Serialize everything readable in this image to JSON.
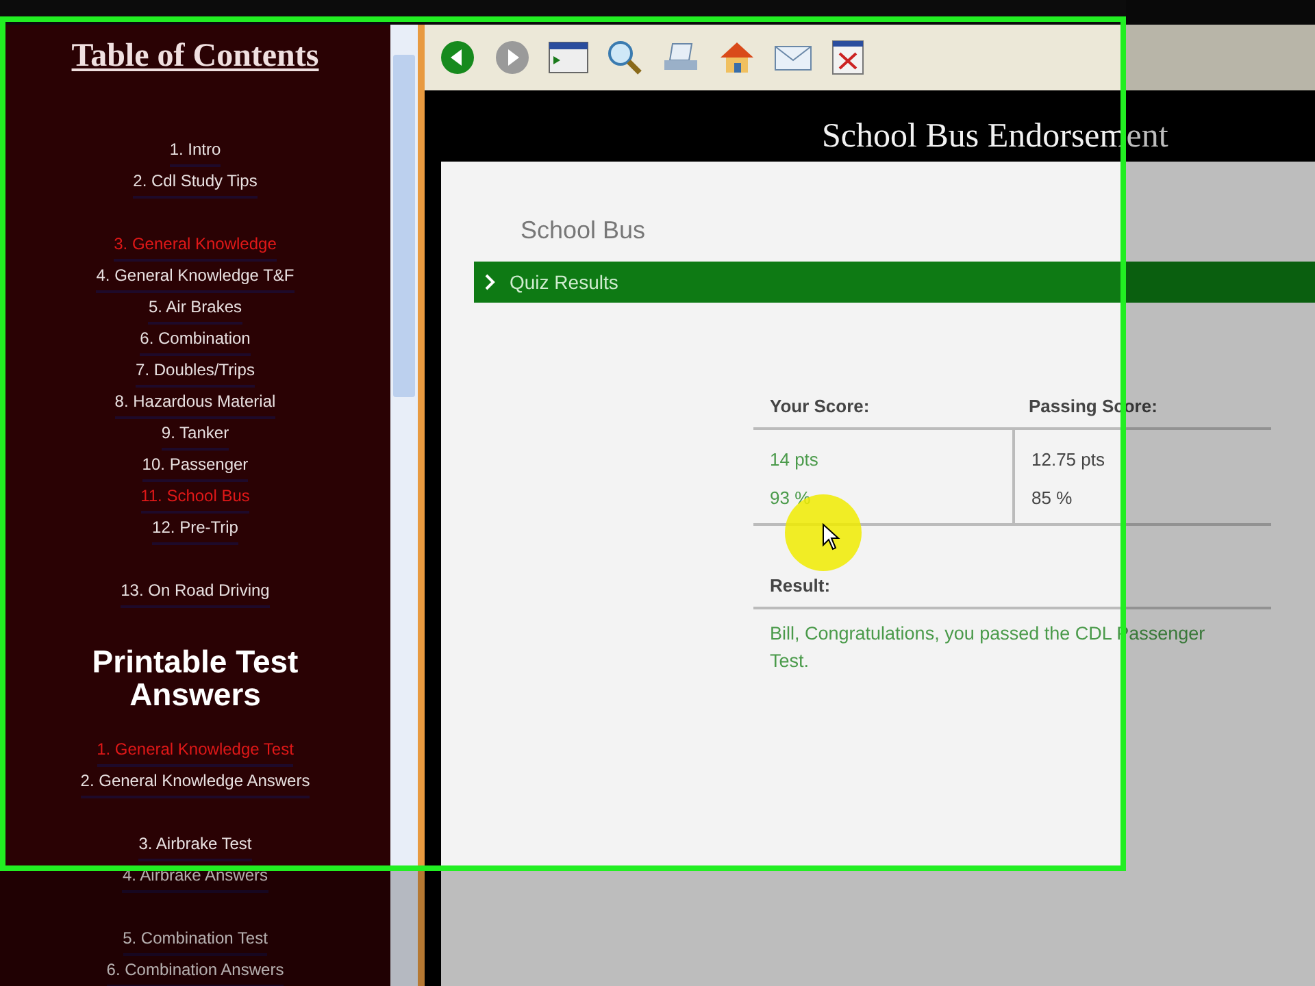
{
  "sidebar": {
    "title": "Table of Contents",
    "groups": [
      [
        {
          "label": "1. Intro",
          "highlighted": false
        },
        {
          "label": "2. Cdl Study Tips",
          "highlighted": false
        }
      ],
      [
        {
          "label": "3. General Knowledge",
          "highlighted": true
        },
        {
          "label": "4. General Knowledge T&F",
          "highlighted": false
        },
        {
          "label": "5. Air Brakes",
          "highlighted": false
        },
        {
          "label": "6. Combination",
          "highlighted": false
        },
        {
          "label": "7. Doubles/Trips",
          "highlighted": false
        },
        {
          "label": "8. Hazardous Material",
          "highlighted": false
        },
        {
          "label": "9. Tanker",
          "highlighted": false
        },
        {
          "label": "10. Passenger",
          "highlighted": false
        },
        {
          "label": "11. School Bus",
          "highlighted": true
        },
        {
          "label": "12. Pre-Trip",
          "highlighted": false
        }
      ],
      [
        {
          "label": "13. On Road Driving",
          "highlighted": false
        }
      ]
    ],
    "section_title": "Printable Test Answers",
    "answer_groups": [
      [
        {
          "label": "1. General Knowledge Test",
          "highlighted": true
        },
        {
          "label": "2. General Knowledge Answers",
          "highlighted": false
        }
      ],
      [
        {
          "label": "3. Airbrake Test",
          "highlighted": false
        },
        {
          "label": "4. Airbrake Answers",
          "highlighted": false
        }
      ],
      [
        {
          "label": "5. Combination Test",
          "highlighted": false
        },
        {
          "label": "6. Combination Answers",
          "highlighted": false
        }
      ]
    ]
  },
  "toolbar": {
    "buttons": [
      {
        "kind": "back",
        "disabled": false
      },
      {
        "kind": "forward",
        "disabled": true
      },
      {
        "kind": "contents"
      },
      {
        "kind": "search"
      },
      {
        "kind": "print"
      },
      {
        "kind": "home"
      },
      {
        "kind": "mail"
      },
      {
        "kind": "close"
      }
    ]
  },
  "header": {
    "title": "School Bus Endorsement"
  },
  "quiz": {
    "title": "School Bus",
    "bar_label": "Quiz Results",
    "your_score_label": "Your Score:",
    "passing_score_label": "Passing Score:",
    "your_score": [
      "14 pts",
      "93 %"
    ],
    "passing_score": [
      "12.75 pts",
      "85 %"
    ],
    "result_label": "Result:",
    "result": "Bill, Congratulations, you passed the CDL Passenger Test."
  }
}
